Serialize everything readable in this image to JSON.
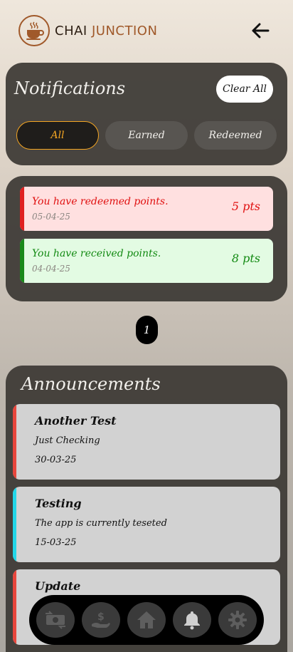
{
  "brand": {
    "word1": "CHAI",
    "word2": "JUNCTION"
  },
  "notifications": {
    "title": "Notifications",
    "clear_all": "Clear All",
    "tabs": [
      {
        "label": "All",
        "active": true
      },
      {
        "label": "Earned",
        "active": false
      },
      {
        "label": "Redeemed",
        "active": false
      }
    ],
    "items": [
      {
        "message": "You have redeemed points.",
        "date": "05-04-25",
        "points": "5 pts",
        "type": "redeemed"
      },
      {
        "message": "You have received points.",
        "date": "04-04-25",
        "points": "8 pts",
        "type": "earned"
      }
    ]
  },
  "pagination": {
    "current": "1"
  },
  "announcements": {
    "title": "Announcements",
    "items": [
      {
        "title": "Another Test",
        "body": "Just Checking",
        "date": "30-03-25",
        "accent": "#e8463c"
      },
      {
        "title": "Testing",
        "body": "The app is currently teseted",
        "date": "15-03-25",
        "accent": "#23d7e8"
      },
      {
        "title": "Update",
        "body": "",
        "date": "",
        "accent": "#e8463c"
      }
    ]
  },
  "nav": {
    "items": [
      {
        "icon": "exchange-money-icon"
      },
      {
        "icon": "hand-coin-icon"
      },
      {
        "icon": "home-icon"
      },
      {
        "icon": "bell-icon"
      },
      {
        "icon": "gear-icon"
      }
    ]
  },
  "colors": {
    "accent": "#f5a623",
    "brand": "#a0592a",
    "redeemed": "#e01010",
    "earned": "#138a13"
  }
}
